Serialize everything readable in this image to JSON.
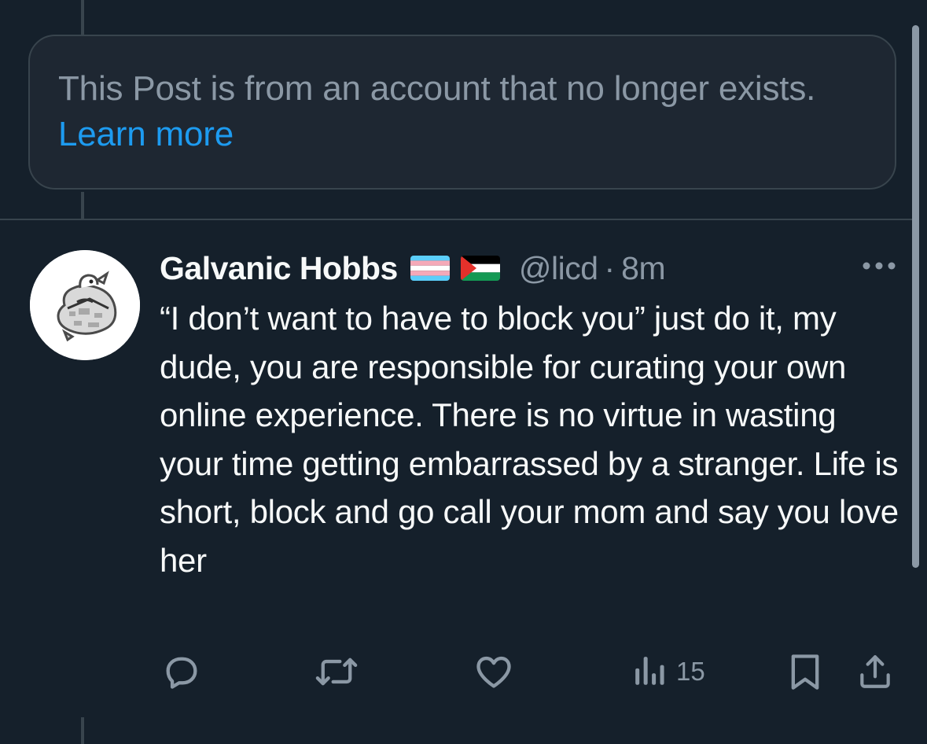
{
  "notice": {
    "text": "This Post is from an account that no longer exists.",
    "link": "Learn more"
  },
  "post": {
    "author_name": "Galvanic Hobbs",
    "flags": [
      "transgender-flag-icon",
      "palestine-flag-icon"
    ],
    "handle": "@licd",
    "separator": "·",
    "time": "8m",
    "body": "“I don’t want to have to block you” just do it, my dude, you are responsible for curating your own online experience. There is no virtue in wasting your time getting embarrassed by a stranger. Life is short, block and go call your mom and say you love her",
    "views_count": "15"
  },
  "actions": [
    "reply-icon",
    "repost-icon",
    "like-icon",
    "views-icon",
    "bookmark-icon",
    "share-icon"
  ],
  "colors": {
    "background": "#15202b",
    "notice_background": "#1e2732",
    "border": "#38444d",
    "secondary_text": "#8b98a5",
    "primary_text": "#f7f9f9",
    "link": "#1d9bf0"
  }
}
